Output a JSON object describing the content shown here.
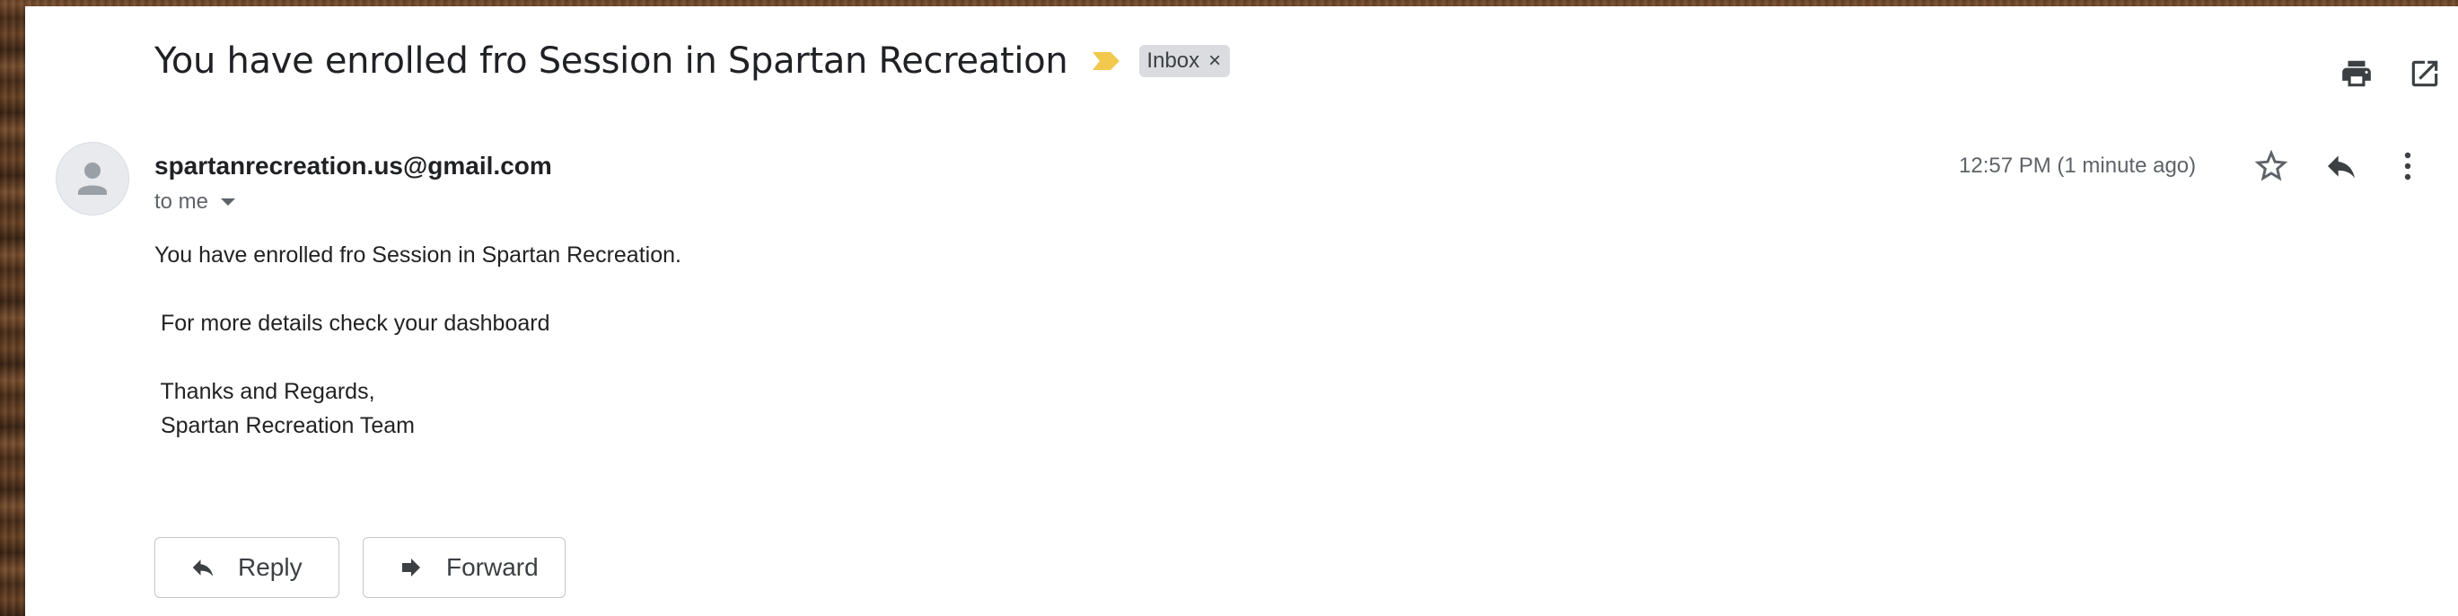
{
  "email": {
    "subject": "You have enrolled fro Session in Spartan Recreation",
    "label_chip": "Inbox",
    "label_chip_close": "×",
    "sender": "spartanrecreation.us@gmail.com",
    "recipient_line": "to me",
    "timestamp": "12:57 PM (1 minute ago)",
    "body": {
      "line1": "You have enrolled fro Session in Spartan Recreation.",
      "line2": " For more details check your dashboard",
      "line3": " Thanks and Regards,",
      "line4": " Spartan Recreation Team"
    }
  },
  "actions": {
    "reply_label": "Reply",
    "forward_label": "Forward"
  },
  "icons": {
    "importance": "importance-marker-icon",
    "print": "print-icon",
    "open_new_window": "open-in-new-window-icon",
    "star": "star-icon",
    "reply": "reply-icon",
    "more": "more-vertical-icon",
    "avatar": "person-avatar-icon",
    "forward": "forward-icon"
  },
  "colors": {
    "importance": "#f2c94c",
    "chip_bg": "#dadce0",
    "text_primary": "#202124",
    "text_secondary": "#5f6368"
  }
}
